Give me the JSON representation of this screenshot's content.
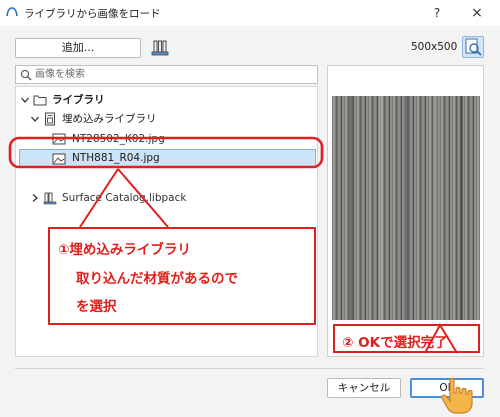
{
  "window": {
    "title": "ライブラリから画像をロード",
    "help_label": "?",
    "close_label": "×"
  },
  "toolbar": {
    "add_label": "追加...",
    "image_size": "500x500"
  },
  "search": {
    "placeholder": "画像を検索"
  },
  "tree": {
    "root_label": "ライブラリ",
    "embedded_label": "埋め込みライブラリ",
    "items": [
      {
        "label": "NT28502_K02.jpg"
      },
      {
        "label": "NTH881_R04.jpg",
        "selected": true
      }
    ],
    "other_label": "Surface Catalog.libpack"
  },
  "buttons": {
    "cancel_label": "キャンセル",
    "ok_label": "OK"
  },
  "annotations": {
    "note1": {
      "line1": "①埋め込みライブラリ",
      "line2": "取り込んだ材質があるので",
      "line3": "を選択"
    },
    "note2": "② OKで選択完了"
  },
  "colors": {
    "annotation": "#e02020",
    "selection": "#cce4f7",
    "ok_border": "#4a8fd8"
  },
  "icons": {
    "title": "archicad-app-icon",
    "library": "library-manager-icon",
    "preview": "preview-zoom-icon",
    "search": "search-icon",
    "folder": "folder-icon",
    "embedded": "embedded-library-icon",
    "image": "image-file-icon",
    "libpack": "libpack-icon",
    "cursor": "hand-pointer-icon"
  }
}
